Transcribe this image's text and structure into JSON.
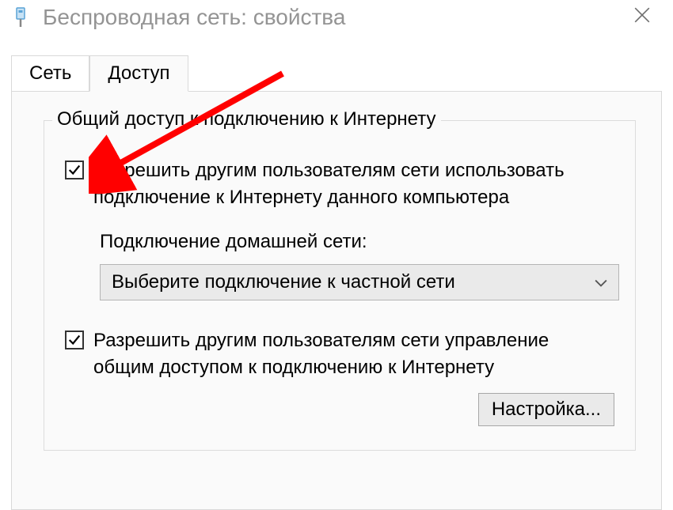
{
  "titlebar": {
    "title": "Беспроводная сеть: свойства"
  },
  "tabs": {
    "network": "Сеть",
    "sharing": "Доступ"
  },
  "group": {
    "legend": "Общий доступ к подключению к Интернету",
    "allow_share": "Разрешить другим пользователям сети использовать подключение к Интернету данного компьютера",
    "home_connection_label": "Подключение домашней сети:",
    "dropdown_value": "Выберите подключение к частной сети",
    "allow_control": "Разрешить другим пользователям сети управление общим доступом к подключению к Интернету",
    "settings_button": "Настройка..."
  }
}
